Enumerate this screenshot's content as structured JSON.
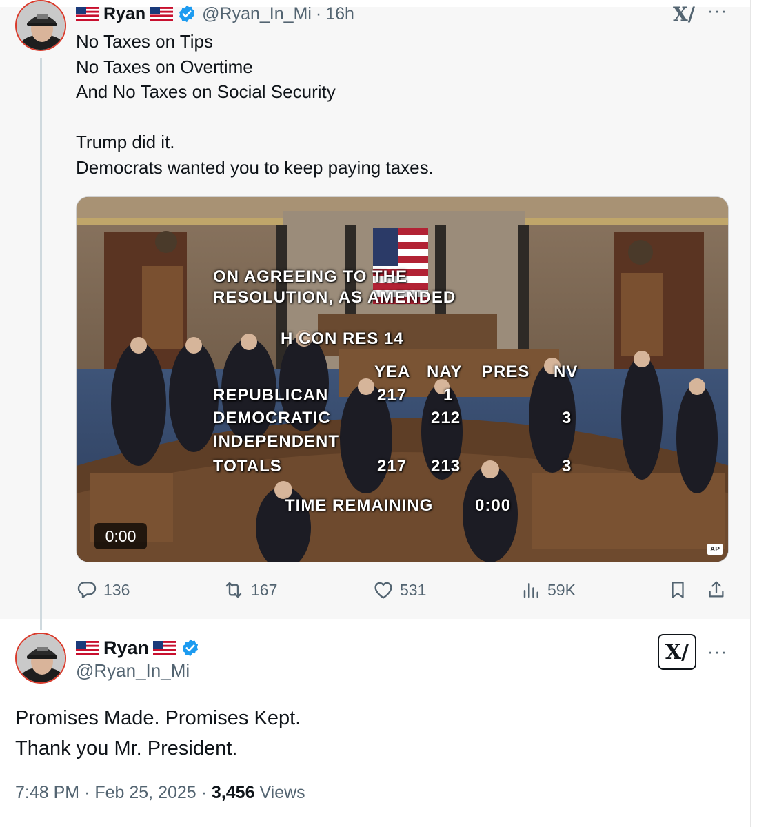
{
  "thread_tweet": {
    "display_name": "Ryan",
    "handle": "@Ryan_In_Mi",
    "time_sep": "·",
    "time": "16h",
    "lines": [
      "No Taxes on Tips",
      "No Taxes on Overtime",
      "And No Taxes on Social Security",
      "",
      "Trump did it.",
      "Democrats wanted you to keep paying taxes."
    ],
    "media": {
      "header_line1": "ON AGREEING TO THE",
      "header_line2": "RESOLUTION, AS AMENDED",
      "measure": "H CON RES 14",
      "columns": [
        "YEA",
        "NAY",
        "PRES",
        "NV"
      ],
      "rows": [
        {
          "party": "REPUBLICAN",
          "yea": "217",
          "nay": "1",
          "pres": "",
          "nv": ""
        },
        {
          "party": "DEMOCRATIC",
          "yea": "",
          "nay": "212",
          "pres": "",
          "nv": "3"
        },
        {
          "party": "INDEPENDENT",
          "yea": "",
          "nay": "",
          "pres": "",
          "nv": ""
        },
        {
          "party": "TOTALS",
          "yea": "217",
          "nay": "213",
          "pres": "",
          "nv": "3"
        }
      ],
      "time_remaining_label": "TIME REMAINING",
      "time_remaining_value": "0:00",
      "video_time": "0:00",
      "ap_label": "AP"
    },
    "actions": {
      "replies": "136",
      "reposts": "167",
      "likes": "531",
      "views": "59K"
    },
    "icons": [
      "reply-icon",
      "repost-icon",
      "like-icon",
      "views-icon",
      "bookmark-icon",
      "share-icon",
      "flag-icon",
      "verified-badge-icon",
      "xai-grok-icon",
      "more-icon"
    ]
  },
  "main_tweet": {
    "display_name": "Ryan",
    "handle": "@Ryan_In_Mi",
    "line1": "Promises Made. Promises Kept.",
    "line2": "Thank you Mr. President.",
    "time": "7:48 PM",
    "sep1": "·",
    "date": "Feb 25, 2025",
    "sep2": "·",
    "views_count": "3,456",
    "views_label": "Views"
  },
  "colors": {
    "verified": "#1d9bf0",
    "text_secondary": "#536471",
    "avatar_ring": "#d93a2b",
    "thread_bg": "#f7f7f7"
  }
}
